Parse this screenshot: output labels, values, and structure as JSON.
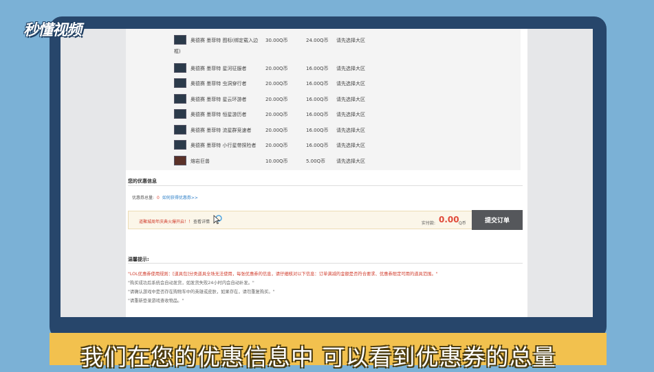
{
  "watermark": {
    "logo_text": "秒懂视频"
  },
  "order": {
    "items": [
      {
        "name": "奥德赛 墨菲特 图标(绑定载入边",
        "name_cont": "框)",
        "original_price": "30.00Q币",
        "discount_price": "24.00Q币",
        "note": "请先选择大区"
      },
      {
        "name": "奥德赛 墨菲特 星河征服者",
        "original_price": "20.00Q币",
        "discount_price": "16.00Q币",
        "note": "请先选择大区"
      },
      {
        "name": "奥德赛 墨菲特 虫洞穿行者",
        "original_price": "20.00Q币",
        "discount_price": "16.00Q币",
        "note": "请先选择大区"
      },
      {
        "name": "奥德赛 墨菲特 星云环游者",
        "original_price": "20.00Q币",
        "discount_price": "16.00Q币",
        "note": "请先选择大区"
      },
      {
        "name": "奥德赛 墨菲特 恒星游历者",
        "original_price": "20.00Q币",
        "discount_price": "16.00Q币",
        "note": "请先选择大区"
      },
      {
        "name": "奥德赛 墨菲特 流星群竞速者",
        "original_price": "20.00Q币",
        "discount_price": "16.00Q币",
        "note": "请先选择大区"
      },
      {
        "name": "奥德赛 墨菲特 小行星带探险者",
        "original_price": "20.00Q币",
        "discount_price": "16.00Q币",
        "note": "请先选择大区"
      },
      {
        "name": "熔岩巨兽",
        "original_price": "10.00Q币",
        "discount_price": "5.00Q币",
        "note": "请先选择大区"
      }
    ]
  },
  "discount": {
    "section_title": "您的优惠信息",
    "coupon_label": "优惠券总量:",
    "coupon_count": "0",
    "coupon_link": "如何获得优惠券>>"
  },
  "checkout": {
    "promo_text": "道聚城周年庆典火爆开启！！",
    "detail_link": "查看详情",
    "paid_label": "实付款:",
    "amount": "0.00",
    "unit": "Q币",
    "submit_label": "提交订单"
  },
  "tips": {
    "title": "温馨提示:",
    "lines": [
      "\"LOL优惠券使用规则：[道具包]分类道具全场无法使用，每张优惠券的信息，请仔细核对以下信息：订单满减的金额是否符合要求、优惠券限定可用的道具范围。\"",
      "\"购买成功后系统会自动发货，如发货失败24小时内会自动补发。\"",
      "\"请确认游戏中是否存在购物车中的英雄或皮肤，如果存在，请勿重复购买。\"",
      "\"请重新登录游戏查收物品。\""
    ]
  },
  "subtitle": {
    "text": "我们在您的优惠信息中 可以看到优惠券的总量"
  },
  "colors": {
    "accent_red": "#e04a3a",
    "link_blue": "#2f80c8",
    "button_gray": "#55575b",
    "banner_yellow": "#f2c14e",
    "frame_navy": "#27466b"
  }
}
